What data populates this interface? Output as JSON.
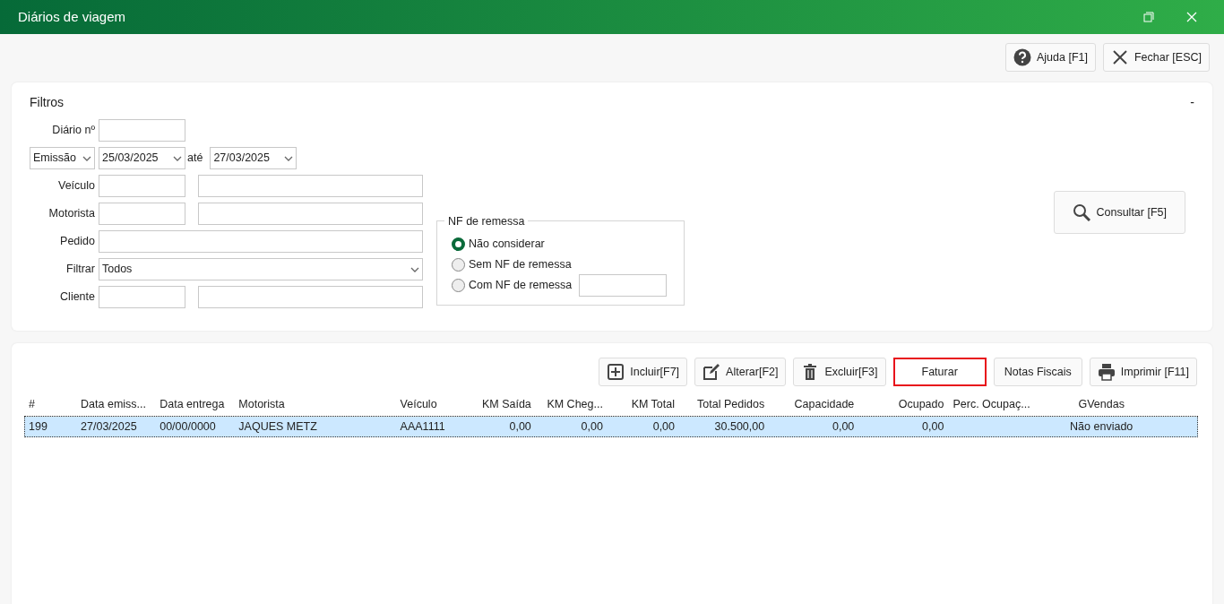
{
  "window": {
    "title": "Diários de viagem"
  },
  "top_buttons": [
    {
      "kind": "help",
      "label": "Ajuda [F1]"
    },
    {
      "kind": "close",
      "label": "Fechar [ESC]"
    }
  ],
  "filters": {
    "title": "Filtros",
    "collapse": "-",
    "diario_label": "Diário nº",
    "date_type": "Emissão",
    "date_from": "25/03/2025",
    "date_sep": "até",
    "date_to": "27/03/2025",
    "veiculo_label": "Veículo",
    "motorista_label": "Motorista",
    "pedido_label": "Pedido",
    "filtrar_label": "Filtrar",
    "filtrar_value": "Todos",
    "cliente_label": "Cliente",
    "nf_group": {
      "title": "NF de remessa",
      "options": [
        {
          "label": "Não considerar",
          "selected": true
        },
        {
          "label": "Sem NF de remessa",
          "selected": false
        },
        {
          "label": "Com NF de remessa",
          "selected": false
        }
      ]
    },
    "search_button": "Consultar [F5]"
  },
  "toolbar": [
    {
      "kind": "add",
      "label": "Incluir[F7]",
      "highlighted": false
    },
    {
      "kind": "edit",
      "label": "Alterar[F2]",
      "highlighted": false
    },
    {
      "kind": "delete",
      "label": "Excluir[F3]",
      "highlighted": false
    },
    {
      "kind": "plain",
      "label": "Faturar",
      "highlighted": true
    },
    {
      "kind": "plain",
      "label": "Notas Fiscais",
      "highlighted": false
    },
    {
      "kind": "print",
      "label": "Imprimir [F11]",
      "highlighted": false
    }
  ],
  "table": {
    "columns": [
      "#",
      "Data emiss...",
      "Data entrega",
      "Motorista",
      "Veículo",
      "KM Saída",
      "KM Cheg...",
      "KM Total",
      "Total Pedidos",
      "Capacidade",
      "Ocupado",
      "Perc. Ocupaç...",
      "GVendas"
    ],
    "rows": [
      {
        "selected": true,
        "cells": [
          "199",
          "27/03/2025",
          "00/00/0000",
          "JAQUES METZ",
          "AAA1111",
          "0,00",
          "0,00",
          "0,00",
          "30.500,00",
          "0,00",
          "0,00",
          "",
          "Não enviado"
        ]
      }
    ]
  }
}
